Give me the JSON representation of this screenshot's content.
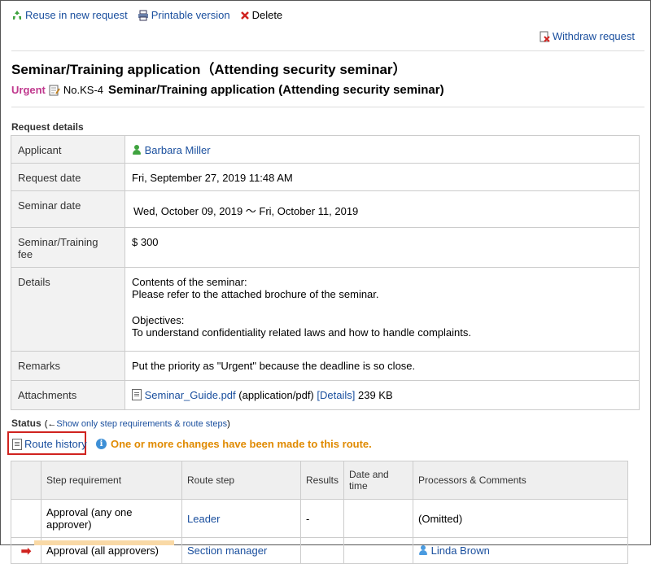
{
  "toolbar": {
    "reuse": "Reuse in new request",
    "print": "Printable version",
    "delete": "Delete"
  },
  "withdraw": "Withdraw request",
  "title": "Seminar/Training application（Attending security seminar）",
  "subtitle": {
    "priority": "Urgent",
    "number": "No.KS-4",
    "text": "Seminar/Training application (Attending security seminar)"
  },
  "request_details_label": "Request details",
  "details": {
    "applicant_label": "Applicant",
    "applicant": "Barbara Miller",
    "request_date_label": "Request date",
    "request_date": "Fri, September 27, 2019 11:48 AM",
    "seminar_date_label": "Seminar date",
    "seminar_date": "Wed, October 09, 2019 ～ Fri, October 11, 2019",
    "fee_label": "Seminar/Training fee",
    "fee": "$ 300",
    "details_label": "Details",
    "details_line1": "Contents of the seminar:",
    "details_line2": "Please refer to the attached brochure of the seminar.",
    "details_line3": "Objectives:",
    "details_line4": "To understand confidentiality related laws and how to handle complaints.",
    "remarks_label": "Remarks",
    "remarks": "Put the priority as \"Urgent\" because the deadline is so close.",
    "attachments_label": "Attachments",
    "attachment_name": "Seminar_Guide.pdf",
    "attachment_type": "(application/pdf)",
    "attachment_details": "[Details]",
    "attachment_size": "239 KB"
  },
  "status": {
    "label": "Status",
    "toggle_prefix": "(←",
    "toggle": "Show only step requirements & route steps",
    "toggle_suffix": ")",
    "route_history": "Route history",
    "changes_notice": "One or more changes have been made to this route."
  },
  "route": {
    "headers": [
      "Step requirement",
      "Route step",
      "Results",
      "Date and time",
      "Processors & Comments"
    ],
    "rows": [
      {
        "requirement": "Approval (any one approver)",
        "step": "Leader",
        "result": "-",
        "datetime": "",
        "processor": "(Omitted)"
      },
      {
        "requirement": "Approval (all approvers)",
        "step": "Section manager",
        "result": "",
        "datetime": "",
        "processor": "Linda Brown"
      }
    ]
  },
  "colors": {
    "link": "#1a4f9e",
    "urgent": "#c0398e",
    "notice": "#e08a00",
    "highlight": "#d0231f"
  }
}
